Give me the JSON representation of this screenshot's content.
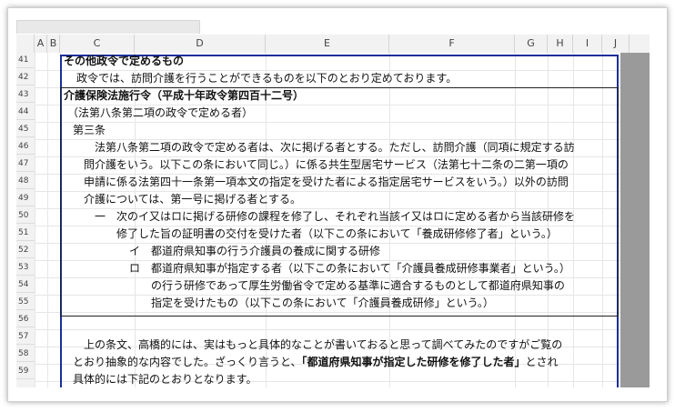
{
  "columns": [
    "A",
    "B",
    "C",
    "D",
    "E",
    "F",
    "G",
    "H",
    "I",
    "J"
  ],
  "rows": [
    "41",
    "42",
    "43",
    "44",
    "45",
    "46",
    "47",
    "48",
    "49",
    "50",
    "51",
    "52",
    "53",
    "54",
    "55",
    "56",
    "57",
    "58",
    "59"
  ],
  "lines": {
    "l41": "その他政令で定めるもの",
    "l42": "政令では、訪問介護を行うことができるものを以下のとおり定めております。",
    "l43": "介護保険法施行令（平成十年政令第四百十二号）",
    "l44": "（法第八条第二項の政令で定める者）",
    "l45": "第三条",
    "l46": "法第八条第二項の政令で定める者は、次に掲げる者とする。ただし、訪問介護（同項に規定する訪",
    "l47": "問介護をいう。以下この条において同じ。）に係る共生型居宅サービス（法第七十二条の二第一項の",
    "l48": "申請に係る法第四十一条第一項本文の指定を受けた者による指定居宅サービスをいう。）以外の訪問",
    "l49": "介護については、第一号に掲げる者とする。",
    "l50_num": "一",
    "l50": "次のイ又はロに掲げる研修の課程を修了し、それぞれ当該イ又はロに定める者から当該研修を",
    "l51": "修了した旨の証明書の交付を受けた者（以下この条において「養成研修修了者」という。）",
    "l52_mark": "イ",
    "l52": "都道府県知事の行う介護員の養成に関する研修",
    "l53_mark": "ロ",
    "l53": "都道府県知事が指定する者（以下この条において「介護員養成研修事業者」という。）",
    "l54": "の行う研修であって厚生労働省令で定める基準に適合するものとして都道府県知事の",
    "l55": "指定を受けたもの（以下この条において「介護員養成研修」という。）",
    "l57": "上の条文、高橋的には、実はもっと具体的なことが書いておると思って調べてみたのですがご覧の",
    "l58_a": "とおり抽象的な内容でした。ざっくり言うと、",
    "l58_b": "「都道府県知事が指定した研修を修了した者」",
    "l58_c": "とされ",
    "l59": "具体的には下記のとおりとなります。"
  }
}
